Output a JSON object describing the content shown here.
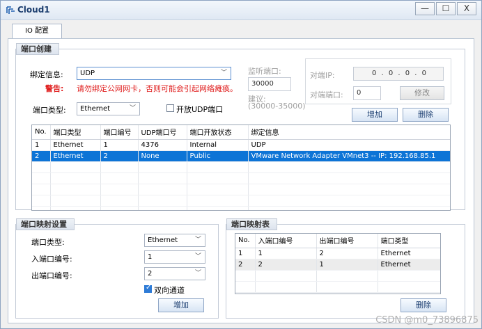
{
  "window": {
    "title": "Cloud1",
    "minimize": "—",
    "maximize": "☐",
    "close": "X"
  },
  "tab": {
    "label": "IO 配置"
  },
  "port_create": {
    "title": "端口创建",
    "bind_label": "绑定信息:",
    "bind_value": "UDP",
    "warning_label": "警告:",
    "warning_text": "请勿绑定公网网卡，否则可能会引起网络瘫痪。",
    "port_type_label": "端口类型:",
    "port_type_value": "Ethernet",
    "open_udp_label": "开放UDP端口",
    "listen_label": "监听端口:",
    "listen_value": "30000",
    "suggest_label": "建议:",
    "suggest_range": "(30000-35000)",
    "peer_ip_label": "对端IP:",
    "peer_ip_value": "0 . 0 . 0 . 0",
    "peer_port_label": "对端端口:",
    "peer_port_value": "0",
    "modify_button": "修改",
    "add_button": "增加",
    "delete_button": "删除",
    "table": {
      "headers": [
        "No.",
        "端口类型",
        "端口编号",
        "UDP端口号",
        "端口开放状态",
        "绑定信息"
      ],
      "rows": [
        [
          "1",
          "Ethernet",
          "1",
          "4376",
          "Internal",
          "UDP"
        ],
        [
          "2",
          "Ethernet",
          "2",
          "None",
          "Public",
          "VMware Network Adapter VMnet3 -- IP: 192.168.85.1"
        ]
      ]
    }
  },
  "mapping_settings": {
    "title": "端口映射设置",
    "port_type_label": "端口类型:",
    "port_type_value": "Ethernet",
    "in_label": "入端口编号:",
    "in_value": "1",
    "out_label": "出端口编号:",
    "out_value": "2",
    "bidirectional_label": "双向通道",
    "add_button": "增加"
  },
  "mapping_table": {
    "title": "端口映射表",
    "headers": [
      "No.",
      "入端口编号",
      "出端口编号",
      "端口类型"
    ],
    "rows": [
      [
        "1",
        "1",
        "2",
        "Ethernet"
      ],
      [
        "2",
        "2",
        "1",
        "Ethernet"
      ]
    ],
    "delete_button": "删除"
  },
  "watermark": "CSDN @m0_73896875"
}
